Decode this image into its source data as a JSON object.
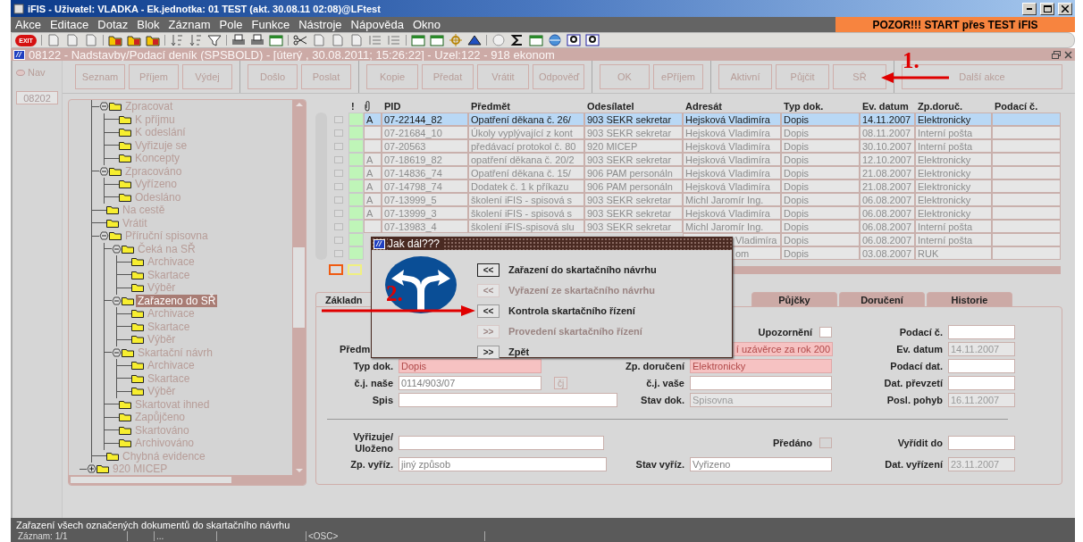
{
  "window": {
    "title": "iFIS - Uživatel: VLADKA - Ek.jednotka: 01 TEST (akt. 30.08.11 02:08)@LFtest"
  },
  "menu": [
    "Akce",
    "Editace",
    "Dotaz",
    "Blok",
    "Záznam",
    "Pole",
    "Funkce",
    "Nástroje",
    "Nápověda",
    "Okno"
  ],
  "banner": "POZOR!!!  START přes TEST iFIS",
  "toolbar": {
    "exit_label": "EXIT"
  },
  "form_window": {
    "title": "08122 - Nadstavby/Podací deník (SPSBOLD) - [úterý  , 30.08.2011; 15:26:22] - Uzel:122 - 918 ekonom"
  },
  "nav": {
    "button": "Nav",
    "field": "08202"
  },
  "actions": [
    [
      "Seznam",
      "Příjem",
      "Výdej"
    ],
    [
      "Došlo",
      "Poslat"
    ],
    [
      "Kopie",
      "Předat",
      "Vrátit",
      "Odpověď"
    ],
    [
      "OK",
      "ePříjem"
    ],
    [
      "Aktivní",
      "Půjčit",
      "SŘ"
    ],
    [
      "Další akce"
    ]
  ],
  "annotations": [
    {
      "label": "1."
    },
    {
      "label": "2."
    }
  ],
  "tree": {
    "items": [
      {
        "children": [
          {
            "label": "Zpracovat",
            "expanded": true,
            "selected": false,
            "children": [
              {
                "label": "K příjmu",
                "selected": false
              },
              {
                "label": "K odeslání",
                "selected": false
              },
              {
                "label": "Vyřizuje se",
                "selected": false
              },
              {
                "label": "Koncepty",
                "selected": false
              }
            ]
          },
          {
            "label": "Zpracováno",
            "expanded": true,
            "selected": false,
            "children": [
              {
                "label": "Vyřízeno",
                "selected": false
              },
              {
                "label": "Odesláno",
                "selected": false
              }
            ]
          },
          {
            "label": "Na cestě",
            "selected": false
          },
          {
            "label": "Vrátit",
            "selected": false
          },
          {
            "label": "Příruční spisovna",
            "expanded": true,
            "selected": false,
            "children": [
              {
                "label": "Čeká na SŘ",
                "expanded": true,
                "selected": false,
                "children": [
                  {
                    "label": "Archivace",
                    "selected": false
                  },
                  {
                    "label": "Skartace",
                    "selected": false
                  },
                  {
                    "label": "Výběr",
                    "selected": false
                  }
                ]
              },
              {
                "label": "Zařazeno do SŘ",
                "expanded": true,
                "selected": true,
                "children": [
                  {
                    "label": "Archivace",
                    "selected": false
                  },
                  {
                    "label": "Skartace",
                    "selected": false
                  },
                  {
                    "label": "Výběr",
                    "selected": false
                  }
                ]
              },
              {
                "label": "Skartační návrh",
                "expanded": true,
                "selected": false,
                "children": [
                  {
                    "label": "Archivace",
                    "selected": false
                  },
                  {
                    "label": "Skartace",
                    "selected": false
                  },
                  {
                    "label": "Výběr",
                    "selected": false
                  }
                ]
              },
              {
                "label": "Skartovat ihned",
                "selected": false
              },
              {
                "label": "Zapůjčeno",
                "selected": false
              },
              {
                "label": "Skartováno",
                "selected": false
              },
              {
                "label": "Archivováno",
                "selected": false
              }
            ]
          },
          {
            "label": "Chybná evidence",
            "selected": false
          }
        ]
      },
      {
        "label": "920 MICEP",
        "expanded": false,
        "selected": false
      }
    ]
  },
  "table": {
    "mark_header": "!",
    "columns": [
      "PID",
      "Předmět",
      "Odesílatel",
      "Adresát",
      "Typ dok.",
      "Ev. datum",
      "Zp.doruč.",
      "Podací č."
    ],
    "rows": [
      {
        "selected": true,
        "checked": false,
        "clipped": false,
        "flag": "A",
        "cells": [
          "07-22144_82",
          "Opatření děkana č. 26/",
          "903 SEKR sekretar",
          "Hejsková Vladimíra",
          "Dopis",
          "14.11.2007",
          "Elektronicky"
        ]
      },
      {
        "selected": false,
        "checked": false,
        "clipped": false,
        "cells": [
          "07-21684_10",
          "Úkoly vyplývající z kont",
          "903 SEKR sekretar",
          "Hejsková Vladimíra",
          "Dopis",
          "08.11.2007",
          "Interní pošta"
        ]
      },
      {
        "selected": false,
        "checked": false,
        "clipped": false,
        "cells": [
          "07-20563",
          "předávací protokol č. 80",
          "920 MICEP",
          "Hejsková Vladimíra",
          "Dopis",
          "30.10.2007",
          "Interní pošta"
        ]
      },
      {
        "selected": false,
        "checked": false,
        "clipped": false,
        "flag": "A",
        "cells": [
          "07-18619_82",
          "opatření děkana č. 20/2",
          "903 SEKR sekretar",
          "Hejsková Vladimíra",
          "Dopis",
          "12.10.2007",
          "Elektronicky"
        ]
      },
      {
        "selected": false,
        "checked": false,
        "clipped": false,
        "flag": "A",
        "cells": [
          "07-14836_74",
          "Opatření děkana č. 15/",
          "906 PAM personáln",
          "Hejsková Vladimíra",
          "Dopis",
          "21.08.2007",
          "Elektronicky"
        ]
      },
      {
        "selected": false,
        "checked": false,
        "clipped": false,
        "flag": "A",
        "cells": [
          "07-14798_74",
          "Dodatek č. 1 k příkazu",
          "906 PAM personáln",
          "Hejsková Vladimíra",
          "Dopis",
          "21.08.2007",
          "Elektronicky"
        ]
      },
      {
        "selected": false,
        "checked": false,
        "clipped": false,
        "flag": "A",
        "cells": [
          "07-13999_5",
          "školení iFIS - spisová s",
          "903 SEKR sekretar",
          "Michl Jaromír Ing.",
          "Dopis",
          "06.08.2007",
          "Elektronicky"
        ]
      },
      {
        "selected": false,
        "checked": false,
        "clipped": false,
        "flag": "A",
        "cells": [
          "07-13999_3",
          "školení iFIS - spisová s",
          "903 SEKR sekretar",
          "Hejsková Vladimíra",
          "Dopis",
          "06.08.2007",
          "Elektronicky"
        ]
      },
      {
        "selected": false,
        "checked": false,
        "clipped": false,
        "cells": [
          "07-13983_4",
          "školení iFIS-spisová slu",
          "903 SEKR sekretar",
          "Michl Jaromír Ing.",
          "Dopis",
          "06.08.2007",
          "Interní pošta"
        ]
      },
      {
        "selected": false,
        "checked": false,
        "clipped": true,
        "cells": [
          null,
          null,
          null,
          "Vladimíra",
          "Dopis",
          "06.08.2007",
          "Interní pošta"
        ]
      },
      {
        "selected": false,
        "checked": false,
        "clipped": true,
        "cells": [
          null,
          null,
          null,
          "om",
          "Dopis",
          "03.08.2007",
          "RUK"
        ]
      }
    ]
  },
  "dialog": {
    "title": "Jak dál???",
    "options": [
      {
        "button": "<<",
        "label": "Zařazení do skartačního návrhu",
        "disabled": false,
        "focused": true
      },
      {
        "button": "<<",
        "label": "Vyřazení ze skartačního návrhu",
        "disabled": true,
        "focused": false
      },
      {
        "button": "<<",
        "label": "Kontrola skartačního řízení",
        "disabled": false,
        "focused": false
      },
      {
        "button": ">>",
        "label": "Provedení skartačního řízení",
        "disabled": true,
        "focused": false
      },
      {
        "button": ">>",
        "label": "Zpět",
        "disabled": false,
        "focused": false
      }
    ]
  },
  "tabs": [
    {
      "label": "Základn",
      "selected": true
    },
    {
      "label": "Půjčky",
      "selected": false
    },
    {
      "label": "Doručení",
      "selected": false
    },
    {
      "label": "Historie",
      "selected": false
    }
  ],
  "form": {
    "rows": [
      {
        "kind": "fields",
        "b": {
          "label": "Upozornění",
          "kind": "checkbox",
          "checked": false
        },
        "c": {
          "label": "Podací č.",
          "kind": "plain"
        }
      },
      {
        "kind": "fields",
        "a": {
          "label": "Předm",
          "value": "í uzávěrce za rok 200",
          "kind": "clipped"
        },
        "c": {
          "label": "Ev. datum",
          "value": "14.11.2007",
          "kind": "readonly"
        }
      },
      {
        "kind": "fields",
        "a": {
          "label": "Typ dok.",
          "value": "Dopis",
          "kind": "required"
        },
        "b": {
          "label": "Zp. doručení",
          "value": "Elektronicky",
          "kind": "required"
        },
        "c": {
          "label": "Podací dat.",
          "kind": "plain"
        }
      },
      {
        "kind": "fields",
        "a": {
          "label": "č.j. naše",
          "value": "0114/903/07",
          "kind": "plain",
          "button": "čj"
        },
        "b": {
          "label": "č.j. vaše",
          "kind": "plain"
        },
        "c": {
          "label": "Dat. převzetí",
          "kind": "plain"
        }
      },
      {
        "kind": "fields",
        "a": {
          "label": "Spis",
          "kind": "plain"
        },
        "b": {
          "label": "Stav dok.",
          "value": "Spisovna",
          "kind": "readonly"
        },
        "c": {
          "label": "Posl. pohyb",
          "value": "16.11.2007",
          "kind": "readonly"
        }
      },
      {
        "kind": "divider"
      },
      {
        "kind": "fields",
        "a": {
          "label": "Vyřizuje/",
          "label_2": "Uloženo",
          "kind": "plain"
        },
        "b": {
          "label": "Předáno",
          "kind": "checkbox",
          "checked": false
        },
        "c": {
          "label": "Vyřídit do",
          "kind": "plain"
        }
      },
      {
        "kind": "fields",
        "a": {
          "label": "Zp. vyříz.",
          "value": "jiný způsob",
          "kind": "plain"
        },
        "b": {
          "label": "Stav vyříz.",
          "value": "Vyřizeno",
          "kind": "plain"
        },
        "c": {
          "label": "Dat. vyřízení",
          "value": "23.11.2007",
          "kind": "readonly"
        }
      }
    ]
  },
  "status_bar": {
    "message": "Zařazení všech označených dokumentů do skartačního návrhu",
    "record": "Záznam: 1/1",
    "dots": "...",
    "mode": "<OSC>"
  }
}
